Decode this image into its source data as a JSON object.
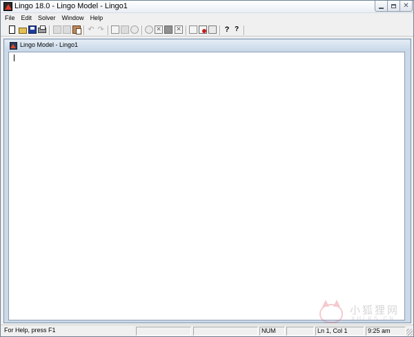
{
  "window": {
    "title": "Lingo 18.0 - Lingo Model - Lingo1",
    "icon": "lingo-app-icon",
    "controls": {
      "minimize_icon": "minimize-icon",
      "maximize_icon": "maximize-icon",
      "close_icon": "close-icon"
    }
  },
  "menu": [
    {
      "label": "File"
    },
    {
      "label": "Edit"
    },
    {
      "label": "Solver"
    },
    {
      "label": "Window"
    },
    {
      "label": "Help"
    }
  ],
  "toolbar": {
    "help_glyph": "?",
    "whatsthis_glyph": "?"
  },
  "document": {
    "title": "Lingo Model - Lingo1",
    "content": ""
  },
  "watermark": {
    "cn": "小狐狸网",
    "en": "XHLKS.CN"
  },
  "statusbar": {
    "help_text": "For Help, press F1",
    "num": "NUM",
    "position": "Ln 1, Col 1",
    "time": "9:25 am"
  }
}
